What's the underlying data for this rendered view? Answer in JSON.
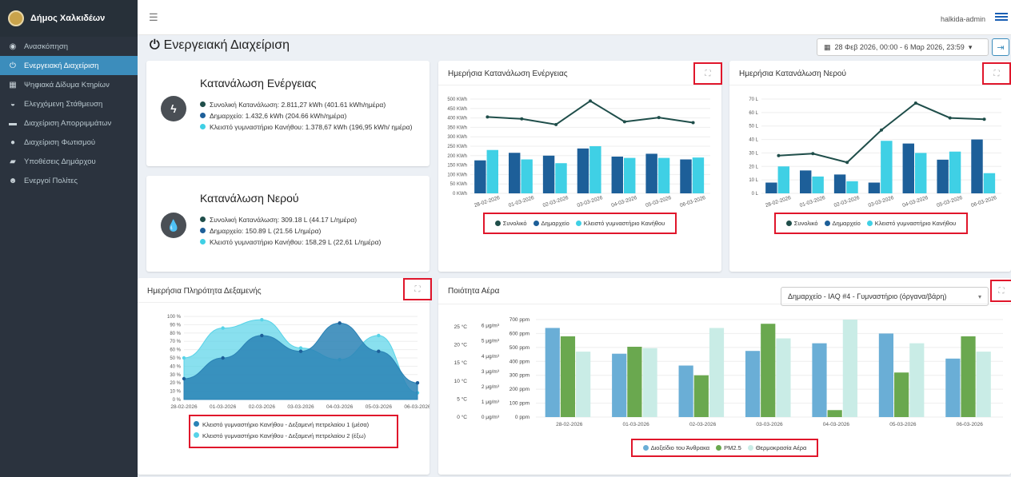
{
  "app": {
    "brand": "Δήμος Χαλκιδέων",
    "user": "halkida-admin"
  },
  "sidebar": {
    "items": [
      {
        "label": "Ανασκόπηση",
        "icon": "dashboard-icon",
        "glyph": "◉"
      },
      {
        "label": "Ενεργειακή Διαχείριση",
        "icon": "power-icon",
        "glyph": "⏻"
      },
      {
        "label": "Ψηφιακά Δίδυμα Κτηρίων",
        "icon": "building-icon",
        "glyph": "▦"
      },
      {
        "label": "Ελεγχόμενη Στάθμευση",
        "icon": "car-icon",
        "glyph": "◒"
      },
      {
        "label": "Διαχείριση Απορριμμάτων",
        "icon": "truck-icon",
        "glyph": "▬"
      },
      {
        "label": "Διαχείριση Φωτισμού",
        "icon": "bulb-icon",
        "glyph": "●"
      },
      {
        "label": "Υποθέσεις Δημάρχου",
        "icon": "folder-icon",
        "glyph": "▰"
      },
      {
        "label": "Ενεργοί Πολίτες",
        "icon": "users-icon",
        "glyph": "☻"
      }
    ]
  },
  "page": {
    "title": "Ενεργειακή Διαχείριση",
    "date_range": "28 Φεβ 2026, 00:00 - 6 Μαρ 2026, 23:59"
  },
  "energy_summary": {
    "title": "Κατανάλωση Ενέργειας",
    "items": [
      "Συνολική Κατανάλωση: 2.811,27 kWh (401.61 kWh/ημέρα)",
      "Δημαρχείο: 1.432,6 kWh (204.66 kWh/ημέρα)",
      "Κλειστό γυμναστήριο Κανήθου: 1.378,67 kWh (196,95 kWh/ ημέρα)"
    ]
  },
  "water_summary": {
    "title": "Κατανάλωση Νερού",
    "items": [
      "Συνολική Κατανάλωση: 309.18 L (44.17 L/ημέρα)",
      "Δημαρχείο: 150.89 L (21.56 L/ημέρα)",
      "Κλειστό γυμναστήριο Κανήθου: 158,29 L (22,61 L/ημέρα)"
    ]
  },
  "colors": {
    "total": "#1f4e4a",
    "city_hall": "#1d5f99",
    "gym": "#3fd0e5",
    "blue_bar": "#6aaed6",
    "green_bar": "#6aa84f",
    "light_bar": "#c9ece6",
    "accent": "#3c8dbc"
  },
  "chart_data": [
    {
      "id": "energy",
      "type": "bar",
      "title": "Ημερήσια Κατανάλωση Ενέργειας",
      "categories": [
        "28-02-2026",
        "01-03-2026",
        "02-03-2026",
        "03-03-2026",
        "04-03-2026",
        "05-03-2026",
        "06-03-2026"
      ],
      "ylim": [
        0,
        500
      ],
      "yticks": [
        "0 KWh",
        "50 KWh",
        "100 KWh",
        "150 KWh",
        "200 KWh",
        "250 KWh",
        "300 KWh",
        "350 KWh",
        "400 KWh",
        "450 KWh",
        "500 KWh"
      ],
      "series": [
        {
          "name": "Συνολικό",
          "kind": "line",
          "values": [
            405,
            395,
            365,
            490,
            380,
            402,
            375
          ]
        },
        {
          "name": "Δημαρχείο",
          "kind": "bar",
          "values": [
            175,
            215,
            200,
            238,
            195,
            210,
            180
          ]
        },
        {
          "name": "Κλειστό γυμναστήριο Κανήθου",
          "kind": "bar",
          "values": [
            230,
            180,
            160,
            250,
            188,
            188,
            190
          ]
        }
      ]
    },
    {
      "id": "water",
      "type": "bar",
      "title": "Ημερήσια Κατανάλωση Νερού",
      "categories": [
        "28-02-2026",
        "01-03-2026",
        "02-03-2026",
        "03-03-2026",
        "04-03-2026",
        "05-03-2026",
        "06-03-2026"
      ],
      "ylim": [
        0,
        70
      ],
      "yticks": [
        "0 L",
        "10 L",
        "20 L",
        "30 L",
        "40 L",
        "50 L",
        "60 L",
        "70 L"
      ],
      "series": [
        {
          "name": "Συνολικό",
          "kind": "line",
          "values": [
            28,
            29.5,
            23,
            47,
            67,
            56,
            55
          ]
        },
        {
          "name": "Δημαρχείο",
          "kind": "bar",
          "values": [
            8,
            17,
            14,
            8,
            37,
            25,
            40
          ]
        },
        {
          "name": "Κλειστό γυμναστήριο Κανήθου",
          "kind": "bar",
          "values": [
            20,
            12.5,
            9,
            39,
            30,
            31,
            15
          ]
        }
      ]
    },
    {
      "id": "tank",
      "type": "area",
      "title": "Ημερήσια Πληρότητα Δεξαμενής",
      "categories": [
        "28-02-2026",
        "01-03-2026",
        "02-03-2026",
        "03-03-2026",
        "04-03-2026",
        "05-03-2026",
        "06-03-2026"
      ],
      "ylim": [
        0,
        100
      ],
      "yticks": [
        "0 %",
        "10 %",
        "20 %",
        "30 %",
        "40 %",
        "50 %",
        "60 %",
        "70 %",
        "80 %",
        "90 %",
        "100 %"
      ],
      "series": [
        {
          "name": "Κλειστό γυμναστήριο Κανήθου - Δεξαμενή πετρελαίου 1 (μέσα)",
          "values": [
            25,
            50,
            77,
            58,
            92,
            58,
            20
          ]
        },
        {
          "name": "Κλειστό γυμναστήριο Κανήθου - Δεξαμενή πετρελαίου 2 (έξω)",
          "values": [
            50,
            86,
            96,
            62,
            48,
            77,
            8
          ]
        }
      ]
    },
    {
      "id": "air",
      "type": "bar",
      "title": "Ποιότητα Αέρα",
      "categories": [
        "28-02-2026",
        "01-03-2026",
        "02-03-2026",
        "03-03-2026",
        "04-03-2026",
        "05-03-2026",
        "06-03-2026"
      ],
      "ylim": [
        0,
        700
      ],
      "yticks": [
        "0 ppm",
        "100 ppm",
        "200 ppm",
        "300 ppm",
        "400 ppm",
        "500 ppm",
        "600 ppm",
        "700 ppm"
      ],
      "yticks2": [
        "0 μg/m³",
        "1 μg/m³",
        "2 μg/m³",
        "3 μg/m³",
        "4 μg/m³",
        "5 μg/m³",
        "6 μg/m³"
      ],
      "yticks3": [
        "0 °C",
        "5 °C",
        "10 °C",
        "15 °C",
        "20 °C",
        "25 °C"
      ],
      "selector": "Δημαρχείο - IAQ #4 - Γυμναστήριο (όργανα/βάρη)",
      "series": [
        {
          "name": "Διοξείδιο του Άνθρακα",
          "values": [
            640,
            455,
            370,
            475,
            530,
            600,
            420
          ]
        },
        {
          "name": "PM2.5",
          "values": [
            580,
            505,
            300,
            670,
            50,
            320,
            580
          ]
        },
        {
          "name": "Θερμοκρασία Αέρα",
          "values": [
            470,
            495,
            640,
            565,
            700,
            530,
            470
          ]
        }
      ]
    }
  ]
}
